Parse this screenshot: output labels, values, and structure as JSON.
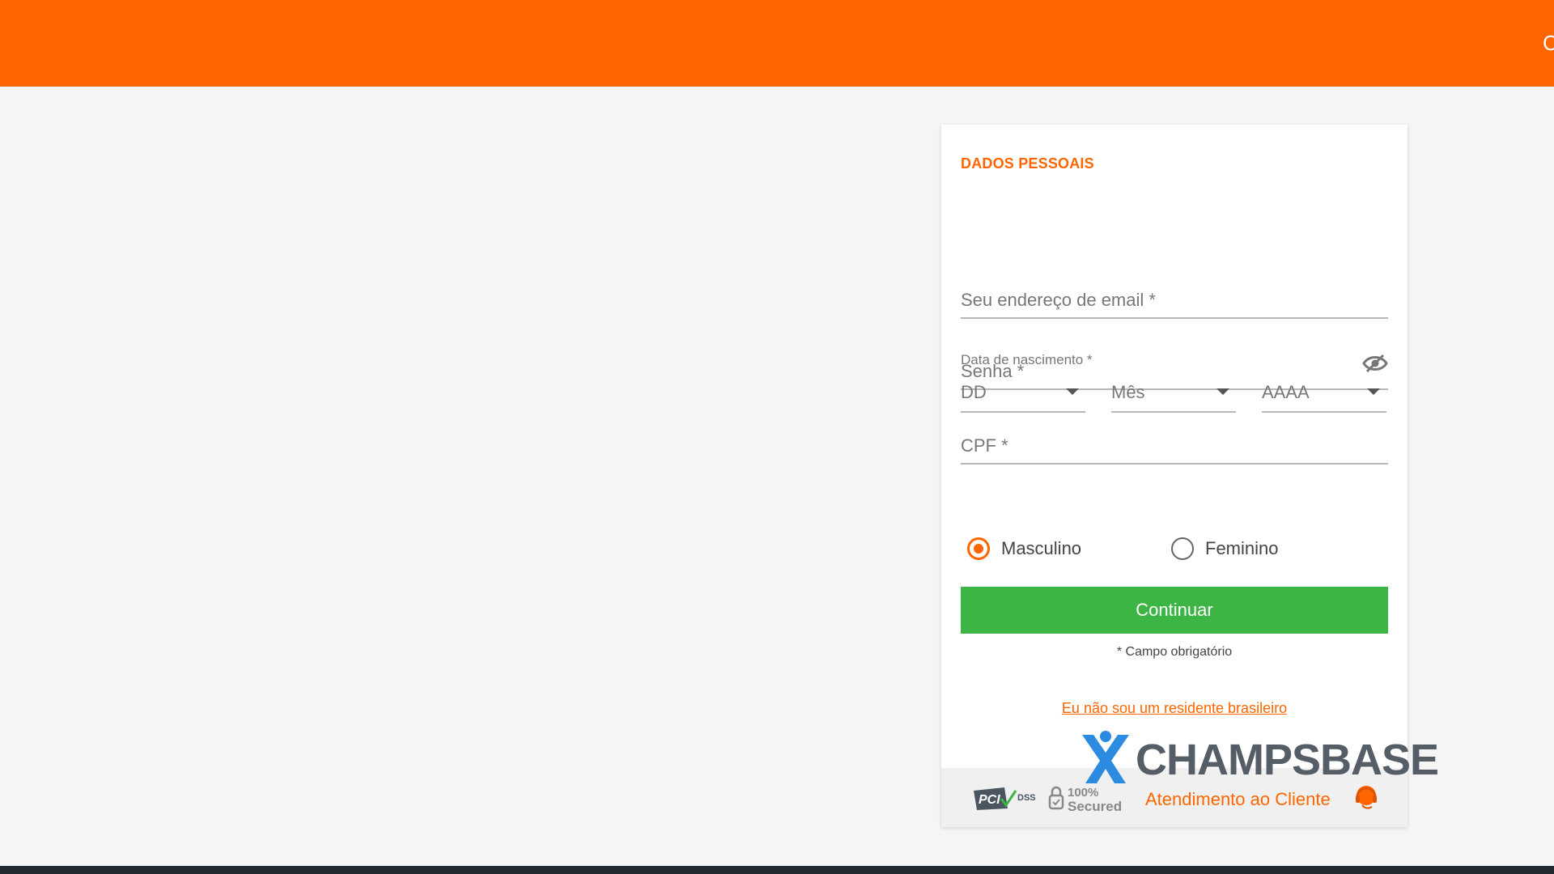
{
  "header": {
    "edge_text": "C"
  },
  "form": {
    "section_title": "DADOS PESSOAIS",
    "email_placeholder": "Seu endereço de email *",
    "password_placeholder": "Senha *",
    "dob_label": "Data de nascimento *",
    "day_placeholder": "DD",
    "month_placeholder": "Mês",
    "year_placeholder": "AAAA",
    "cpf_placeholder": "CPF *",
    "gender_options": [
      {
        "label": "Masculino",
        "checked": true
      },
      {
        "label": "Feminino",
        "checked": false
      }
    ],
    "continue_label": "Continuar",
    "required_note": "* Campo obrigatório",
    "non_resident_link": "Eu não sou um residente brasileiro"
  },
  "footer": {
    "pci_text": "PCI DSS",
    "secured_text": "100% Secured",
    "support_label": "Atendimento ao Cliente",
    "support_icon": "headset-icon"
  },
  "watermark": {
    "text": "CHAMPSBASE"
  },
  "colors": {
    "brand": "#ff6600",
    "button": "#3db545",
    "background": "#f5f5f5"
  }
}
